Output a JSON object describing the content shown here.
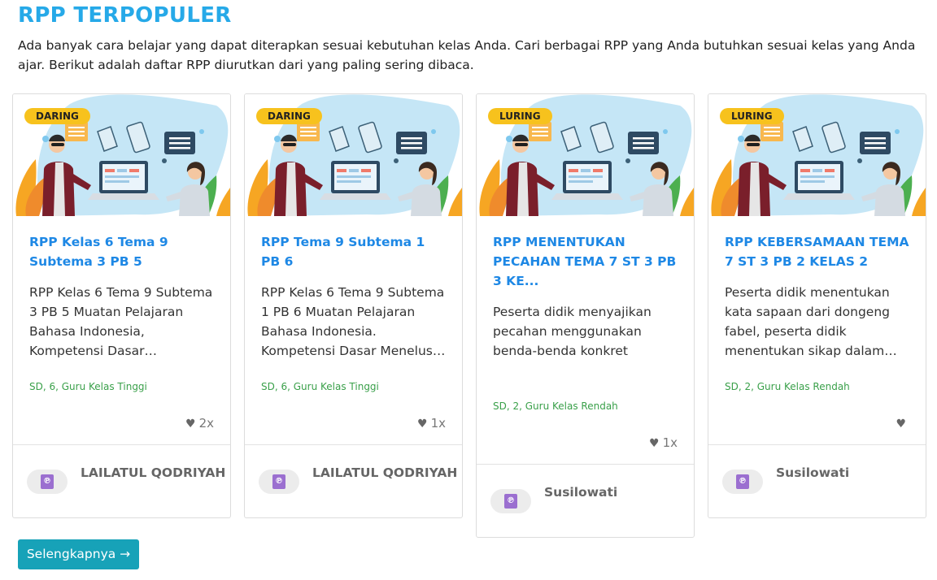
{
  "section": {
    "title": "RPP TERPOPULER",
    "intro": "Ada banyak cara belajar yang dapat diterapkan sesuai kebutuhan kelas Anda. Cari berbagai RPP yang Anda butuhkan sesuai kelas yang Anda ajar. Berikut adalah daftar RPP diurutkan dari yang paling sering dibaca."
  },
  "cards": [
    {
      "badge": "DARING",
      "title": "RPP Kelas 6 Tema 9 Subtema 3 PB 5",
      "description": "RPP Kelas 6 Tema 9 Subtema 3 PB 5 Muatan Pelajaran Bahasa Indonesia, Kompetensi Dasar…",
      "meta": "SD, 6, Guru Kelas Tinggi",
      "likes": "2x",
      "author": "LAILATUL QODRIYAH"
    },
    {
      "badge": "DARING",
      "title": "RPP Tema 9 Subtema 1 PB 6",
      "description": "RPP Kelas 6 Tema 9 Subtema 1 PB 6 Muatan Pelajaran Bahasa Indonesia. Kompetensi Dasar Menelus…",
      "meta": "SD, 6, Guru Kelas Tinggi",
      "likes": "1x",
      "author": "LAILATUL QODRIYAH"
    },
    {
      "badge": "LURING",
      "title": "RPP MENENTUKAN PECAHAN TEMA 7 ST 3 PB 3 KE...",
      "description": "Peserta didik menyajikan pecahan menggunakan benda-benda konkret",
      "meta": "SD, 2, Guru Kelas Rendah",
      "likes": "1x",
      "author": "Susilowati"
    },
    {
      "badge": "LURING",
      "title": "RPP KEBERSAMAAN TEMA 7 ST 3 PB 2 KELAS 2",
      "description": "Peserta didik menentukan kata sapaan dari dongeng fabel, peserta didik menentukan sikap dalam…",
      "meta": "SD, 2, Guru Kelas Rendah",
      "likes": "",
      "author": "Susilowati"
    }
  ],
  "icons": {
    "like": "heart-icon",
    "file": "pdf-file-icon",
    "arrow": "arrow-right-icon"
  },
  "colors": {
    "title": "#26a9e8",
    "card_title": "#1e88e5",
    "meta": "#3aa04a",
    "badge": "#f7c21d",
    "button": "#17a2b8"
  },
  "more_button": "Selengkapnya →"
}
